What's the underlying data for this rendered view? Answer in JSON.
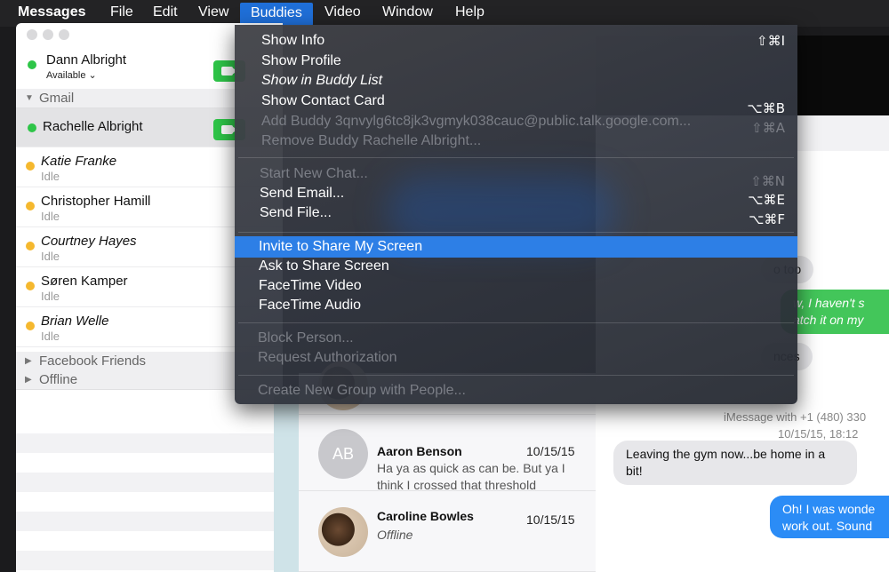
{
  "menubar": {
    "items": [
      "Messages",
      "File",
      "Edit",
      "View",
      "Buddies",
      "Video",
      "Window",
      "Help"
    ]
  },
  "me": {
    "name": "Dann Albright",
    "status": "Available"
  },
  "groups": {
    "gmail": "Gmail",
    "facebook": "Facebook Friends",
    "offline": "Offline"
  },
  "buddies": [
    {
      "name": "Rachelle Albright",
      "status": ""
    },
    {
      "name": "Katie Franke",
      "status": "Idle"
    },
    {
      "name": "Christopher Hamill",
      "status": "Idle"
    },
    {
      "name": "Courtney Hayes",
      "status": "Idle"
    },
    {
      "name": "Søren Kamper",
      "status": "Idle"
    },
    {
      "name": "Brian Welle",
      "status": "Idle"
    }
  ],
  "buddies_menu": {
    "items": [
      {
        "label": "Show Info",
        "shortcut": "⇧⌘I"
      },
      {
        "label": "Show Profile",
        "shortcut": ""
      },
      {
        "label": "Show in Buddy List",
        "shortcut": ""
      },
      {
        "label": "Show Contact Card",
        "shortcut": "⌥⌘B"
      },
      {
        "label": "Add Buddy 3qnvylg6tc8jk3vgmyk038cauc@public.talk.google.com...",
        "shortcut": "⇧⌘A"
      },
      {
        "label": "Remove Buddy Rachelle Albright...",
        "shortcut": ""
      },
      {
        "label": "Start New Chat...",
        "shortcut": "⇧⌘N"
      },
      {
        "label": "Send Email...",
        "shortcut": "⌥⌘E"
      },
      {
        "label": "Send File...",
        "shortcut": "⌥⌘F"
      },
      {
        "label": "Invite to Share My Screen",
        "shortcut": ""
      },
      {
        "label": "Ask to Share Screen",
        "shortcut": ""
      },
      {
        "label": "FaceTime Video",
        "shortcut": ""
      },
      {
        "label": "FaceTime Audio",
        "shortcut": ""
      },
      {
        "label": "Block Person...",
        "shortcut": ""
      },
      {
        "label": "Request Authorization",
        "shortcut": ""
      },
      {
        "label": "Create New Group with People...",
        "shortcut": ""
      }
    ]
  },
  "conversations": [
    {
      "initials": "AB",
      "name": "Aaron Benson",
      "date": "10/15/15",
      "preview": "Ha ya as quick as can be. But ya I think I crossed that threshold"
    },
    {
      "initials": "",
      "name": "Caroline Bowles",
      "date": "10/15/15",
      "preview": "Offline"
    }
  ],
  "chat": {
    "partial_bubbles": [
      "o too",
      "w, I haven't s",
      "atch it on my",
      "nces"
    ],
    "service_line": "iMessage with +1 (480) 330",
    "timestamp": "10/15/15, 18:12",
    "incoming": "Leaving the gym now...be home in a bit!",
    "outgoing": "Oh! I was wonde work out. Sound"
  }
}
